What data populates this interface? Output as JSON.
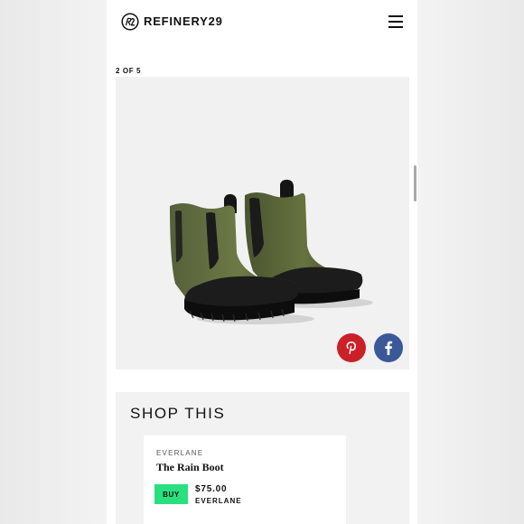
{
  "header": {
    "brand": "REFINERY29",
    "logo_icon": "r29-logo-icon",
    "menu_icon": "hamburger-menu-icon"
  },
  "gallery": {
    "counter": "2 OF 5",
    "image": "green-rubber-chelsea-rain-boots",
    "share": [
      {
        "network": "Pinterest",
        "icon": "pinterest-icon",
        "color": "#cb2027"
      },
      {
        "network": "Facebook",
        "icon": "facebook-icon",
        "color": "#3b5998"
      }
    ]
  },
  "shop": {
    "title": "SHOP THIS",
    "items": [
      {
        "merchant": "EVERLANE",
        "product": "The Rain Boot",
        "buy_label": "BUY",
        "price": "$75.00",
        "retailer": "EVERLANE"
      }
    ]
  },
  "colors": {
    "buy_button": "#29e07f",
    "boot_green": "#5a6537",
    "boot_sole": "#141414"
  }
}
